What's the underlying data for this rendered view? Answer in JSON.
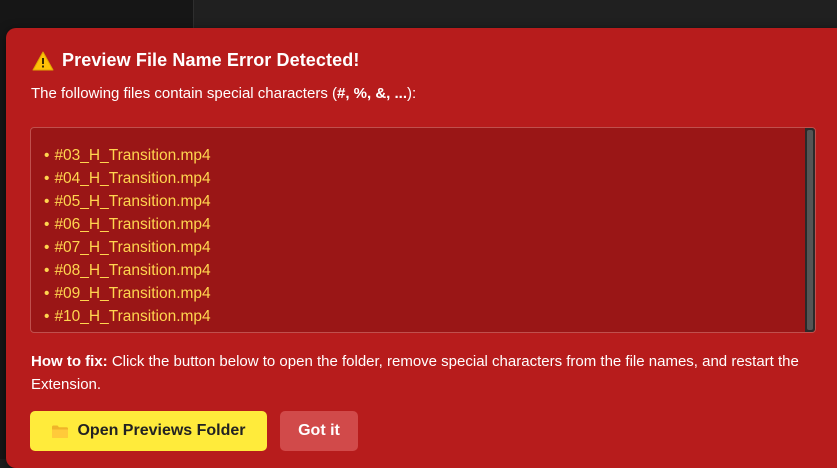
{
  "dialog": {
    "title": "Preview File Name Error Detected!",
    "warning_icon": "warning-triangle-icon",
    "subtitle_prefix": "The following files contain special characters (",
    "subtitle_chars": "#, %, &, ...",
    "subtitle_suffix": "):",
    "files": [
      "#03_H_Transition.mp4",
      "#04_H_Transition.mp4",
      "#05_H_Transition.mp4",
      "#06_H_Transition.mp4",
      "#07_H_Transition.mp4",
      "#08_H_Transition.mp4",
      "#09_H_Transition.mp4",
      "#10_H_Transition.mp4"
    ],
    "bullet": "•",
    "howto_label": "How to fix:",
    "howto_text": " Click the button below to open the folder, remove special characters from the file names, and restart the Extension.",
    "open_button_label": "Open Previews Folder",
    "open_button_icon": "folder-icon",
    "got_it_label": "Got it"
  },
  "colors": {
    "dialog_bg": "#b71c1c",
    "file_box_bg": "#9a1616",
    "file_text": "#ffd54f",
    "primary_button": "#ffeb3b",
    "secondary_button": "#d14a4a"
  }
}
